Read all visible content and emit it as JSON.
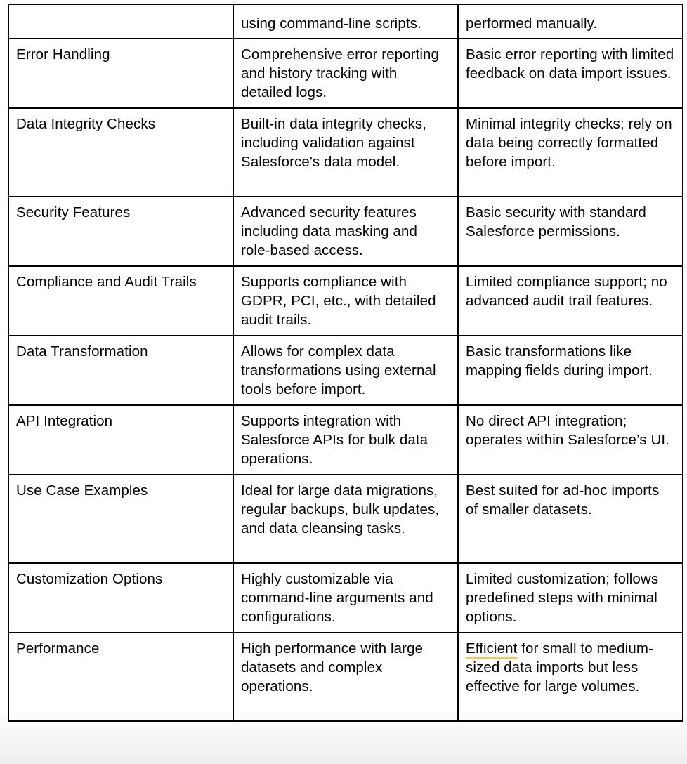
{
  "table": {
    "rows": [
      {
        "feature": "",
        "col_a": "using command-line scripts.",
        "col_b": "performed manually."
      },
      {
        "feature": "Error Handling",
        "col_a": "Comprehensive error reporting and history tracking with detailed logs.",
        "col_b": "Basic error reporting with limited feedback on data import issues."
      },
      {
        "feature": "Data Integrity Checks",
        "col_a": "Built-in data integrity checks, including validation against Salesforce's data model.",
        "col_b": "Minimal integrity checks; rely on data being correctly formatted before import."
      },
      {
        "feature": "Security Features",
        "col_a": "Advanced security features including data masking and role-based access.",
        "col_b": "Basic security with standard Salesforce permissions."
      },
      {
        "feature": "Compliance and Audit Trails",
        "col_a": "Supports compliance with GDPR, PCI, etc., with detailed audit trails.",
        "col_b": "Limited compliance support; no advanced audit trail features."
      },
      {
        "feature": "Data Transformation",
        "col_a": "Allows for complex data transformations using external tools before import.",
        "col_b": "Basic transformations like mapping fields during import."
      },
      {
        "feature": "API Integration",
        "col_a": "Supports integration with Salesforce APIs for bulk data operations.",
        "col_b": "No direct API integration; operates within Salesforce’s UI."
      },
      {
        "feature": "Use Case Examples",
        "col_a": "Ideal for large data migrations, regular backups, bulk updates, and data cleansing tasks.",
        "col_b": "Best suited for ad-hoc imports of smaller datasets."
      },
      {
        "feature": "Customization Options",
        "col_a": "Highly customizable via command-line arguments and configurations.",
        "col_b": "Limited customization; follows predefined steps with minimal options."
      },
      {
        "feature": "Performance",
        "col_a": "High performance with large datasets and complex operations.",
        "col_b_flagged_word": "Efficient",
        "col_b_rest": " for small to medium-sized data imports but less effective for large volumes."
      }
    ]
  },
  "colors": {
    "border": "#000000",
    "text": "#000000",
    "spellcheck_underline": "#f5c94a"
  }
}
